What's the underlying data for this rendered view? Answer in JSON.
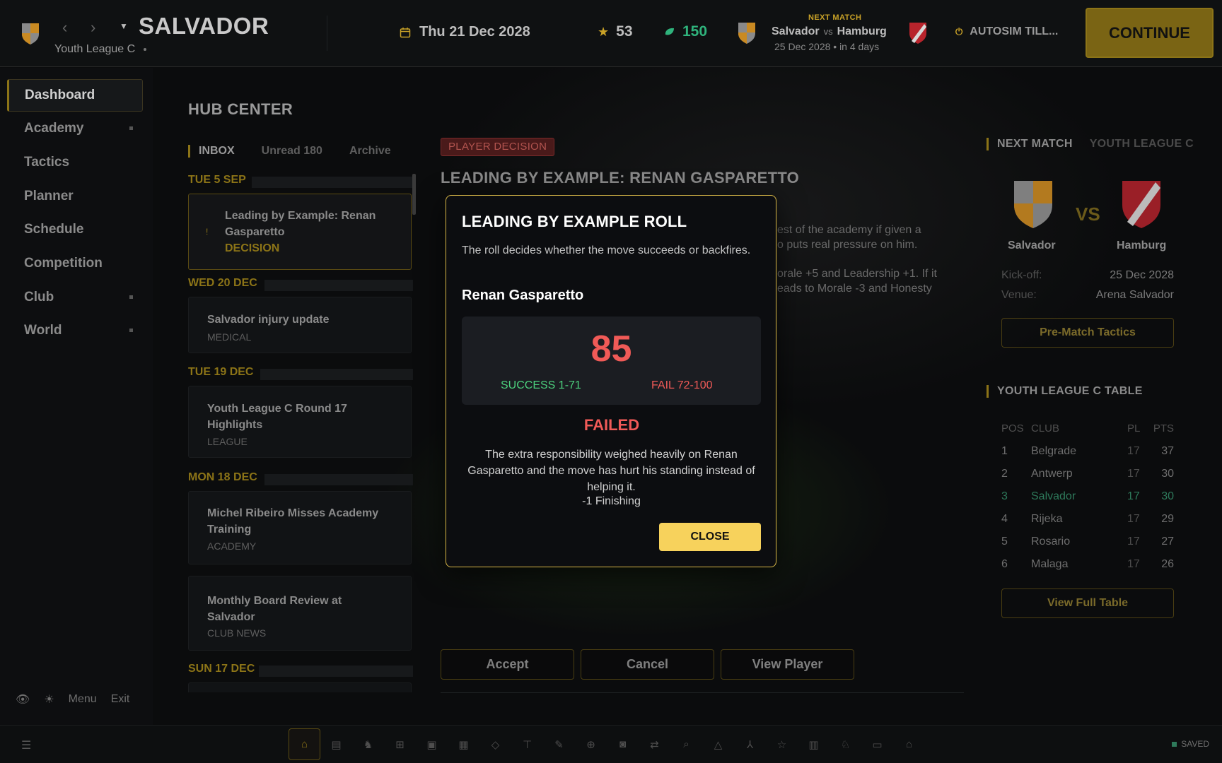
{
  "colors": {
    "accent": "#f7d25c",
    "danger": "#f05a57",
    "success": "#4cd07d",
    "cash": "#2fb37c"
  },
  "header": {
    "club_name": "SALVADOR",
    "league": "Youth League C",
    "date": "Thu 21 Dec 2028",
    "reputation": "53",
    "cash": "150",
    "next_match_label": "NEXT MATCH",
    "home": "Salvador",
    "vs": "vs",
    "away": "Hamburg",
    "when": "25 Dec 2028 • in 4 days",
    "autosim": "AUTOSIM TILL...",
    "continue": "CONTINUE"
  },
  "sidebar": {
    "items": [
      {
        "label": "Dashboard"
      },
      {
        "label": "Academy"
      },
      {
        "label": "Tactics"
      },
      {
        "label": "Planner"
      },
      {
        "label": "Schedule"
      },
      {
        "label": "Competition"
      },
      {
        "label": "Club"
      },
      {
        "label": "World"
      }
    ],
    "footer": {
      "menu": "Menu",
      "exit": "Exit"
    }
  },
  "hub": {
    "title": "HUB CENTER"
  },
  "inbox": {
    "tabs": [
      "INBOX",
      "Unread 180",
      "Archive"
    ],
    "days": [
      "TUE 5 SEP",
      "WED 20 DEC",
      "TUE 19 DEC",
      "MON 18 DEC",
      "SUN 17 DEC"
    ],
    "messages": [
      {
        "title_line1": "Leading by Example: Renan",
        "title_line2": "Gasparetto",
        "category": "DECISION"
      },
      {
        "title_line1": "Salvador injury update",
        "title_line2": "",
        "category": "MEDICAL"
      },
      {
        "title_line1": "Youth League C Round 17",
        "title_line2": "Highlights",
        "category": "LEAGUE"
      },
      {
        "title_line1": "Michel Ribeiro Misses Academy",
        "title_line2": "Training",
        "category": "ACADEMY"
      },
      {
        "title_line1": "Monthly Board Review at",
        "title_line2": "Salvador",
        "category": "CLUB NEWS"
      }
    ]
  },
  "detail": {
    "tag": "PLAYER DECISION",
    "title": "LEADING BY EXAMPLE: RENAN GASPARETTO",
    "frag1": "est of the academy if given a",
    "frag2": "o puts real pressure on him.",
    "frag3": "orale +5 and Leadership +1. If it",
    "frag4": "eads to Morale -3 and Honesty",
    "buttons": {
      "accept": "Accept",
      "cancel": "Cancel",
      "view": "View Player"
    }
  },
  "right_panel": {
    "next_match": "NEXT MATCH",
    "league_tab": "YOUTH LEAGUE C",
    "vs": "VS",
    "home": "Salvador",
    "away": "Hamburg",
    "kickoff_label": "Kick-off:",
    "kickoff": "25 Dec 2028",
    "venue_label": "Venue:",
    "venue": "Arena Salvador",
    "tactics_btn": "Pre-Match Tactics",
    "table_title": "YOUTH LEAGUE C TABLE",
    "table_headers": {
      "pos": "POS",
      "club": "CLUB",
      "pl": "PL",
      "pts": "PTS"
    },
    "table": [
      {
        "pos": "1",
        "club": "Belgrade",
        "pl": "17",
        "pts": "37"
      },
      {
        "pos": "2",
        "club": "Antwerp",
        "pl": "17",
        "pts": "30"
      },
      {
        "pos": "3",
        "club": "Salvador",
        "pl": "17",
        "pts": "30"
      },
      {
        "pos": "4",
        "club": "Rijeka",
        "pl": "17",
        "pts": "29"
      },
      {
        "pos": "5",
        "club": "Rosario",
        "pl": "17",
        "pts": "27"
      },
      {
        "pos": "6",
        "club": "Malaga",
        "pl": "17",
        "pts": "26"
      }
    ],
    "full_table_btn": "View Full Table"
  },
  "bottom_bar": {
    "saved": "SAVED"
  },
  "modal": {
    "title": "LEADING BY EXAMPLE ROLL",
    "description": "The roll decides whether the move succeeds or backfires.",
    "player": "Renan Gasparetto",
    "roll": "85",
    "success_range": "SUCCESS 1-71",
    "fail_range": "FAIL 72-100",
    "result": "FAILED",
    "outcome": "The extra responsibility weighed heavily on Renan Gasparetto and the move has hurt his standing instead of helping it.",
    "effect": "-1 Finishing",
    "close": "CLOSE"
  }
}
